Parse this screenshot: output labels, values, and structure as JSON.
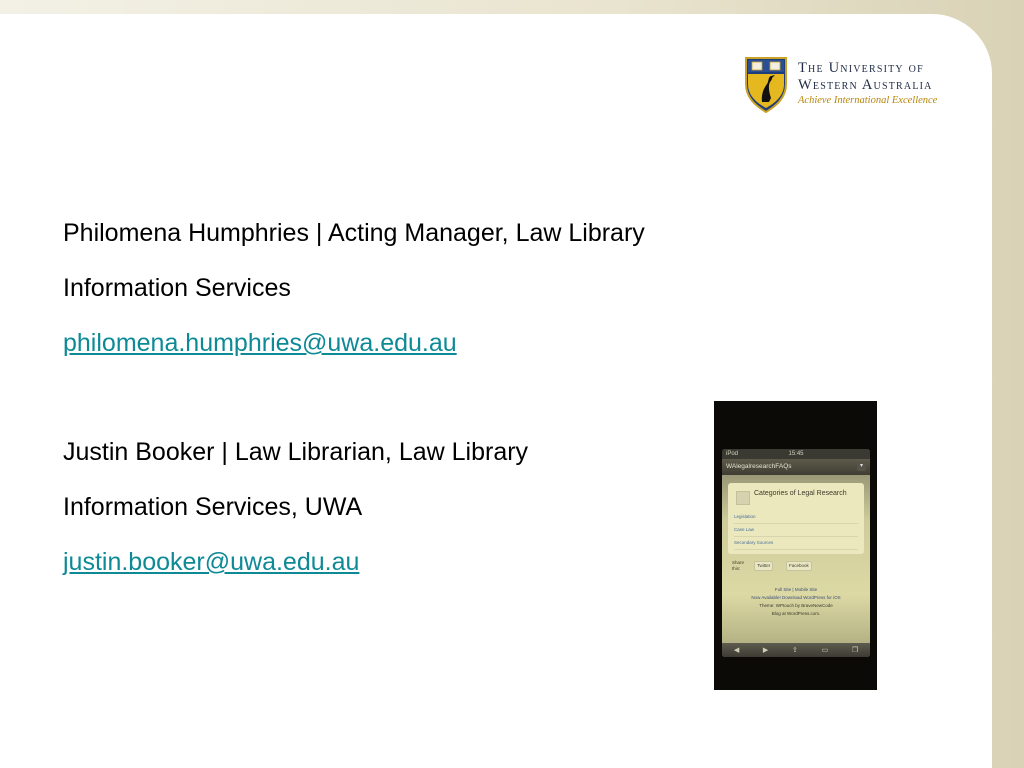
{
  "logo": {
    "line1": "The University of",
    "line2": "Western Australia",
    "tagline": "Achieve International Excellence"
  },
  "contacts": [
    {
      "name_role": "Philomena Humphries | Acting Manager, Law Library",
      "unit": "Information Services",
      "email": "philomena.humphries@uwa.edu.au"
    },
    {
      "name_role": "Justin Booker | Law Librarian, Law Library",
      "unit": "Information Services, UWA",
      "email": "justin.booker@uwa.edu.au"
    }
  ],
  "phone_photo": {
    "status_left": "iPod",
    "status_time": "15:45",
    "site_title": "WAlegalresearchFAQs",
    "card_title": "Categories of Legal Research",
    "links": [
      "Legislation",
      "Case Law",
      "Secondary Sources"
    ],
    "share_label": "Share this:",
    "share_twitter": "Twitter",
    "share_facebook": "Facebook",
    "footer_site": "Full Site | Mobile Site",
    "footer_wp": "Now Available! Download WordPress for iOS",
    "footer_theme": "Theme: WPtouch by BraveNewCode",
    "footer_blog": "Blog at WordPress.com."
  },
  "colors": {
    "link": "#0e8a96",
    "text": "#000000",
    "logo_navy": "#1f2a44",
    "logo_gold": "#b8860b"
  }
}
